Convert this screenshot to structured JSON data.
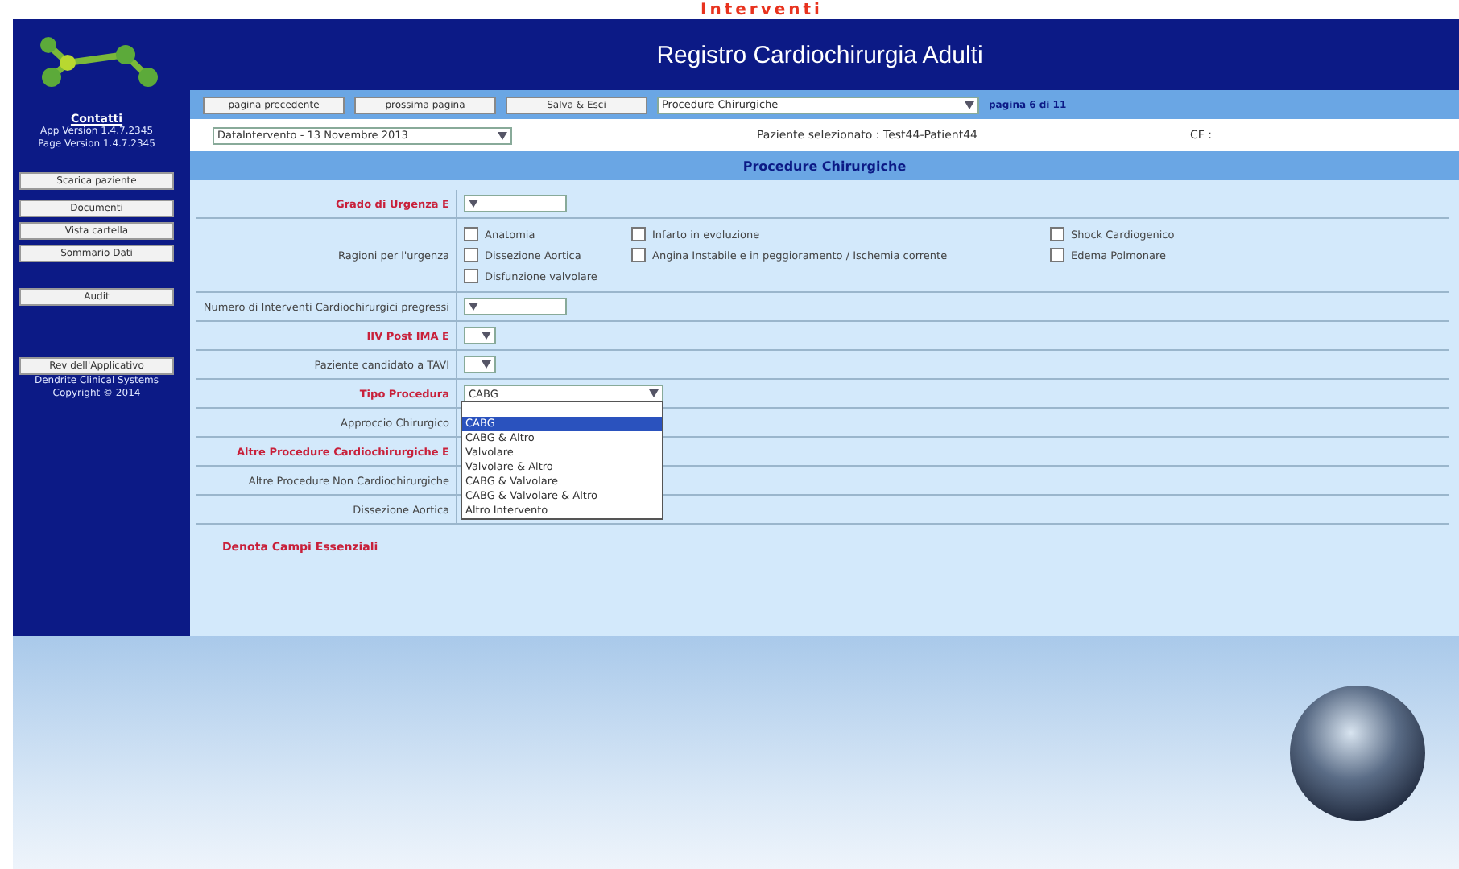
{
  "banner": {
    "title": "Interventi"
  },
  "header": {
    "title": "Registro Cardiochirurgia Adulti"
  },
  "sidebar": {
    "link": "Contatti",
    "versions": [
      "App Version 1.4.7.2345",
      "Page Version 1.4.7.2345"
    ],
    "buttons": [
      "Scarica paziente",
      "Documenti",
      "Vista cartella",
      "Sommario Dati"
    ],
    "audit": "Audit",
    "about": "Rev dell'Applicativo",
    "footer": [
      "Dendrite Clinical Systems",
      "Copyright © 2014"
    ]
  },
  "nav": {
    "buttons": [
      "pagina precedente",
      "prossima pagina",
      "Salva & Esci"
    ],
    "page_select": "Procedure Chirurgiche",
    "page_info": "pagina 6 di 11"
  },
  "patient": {
    "intervention": "DataIntervento - 13 Novembre 2013",
    "selected": "Paziente selezionato : Test44-Patient44",
    "cf": "CF :"
  },
  "section": {
    "title": "Procedure Chirurgiche"
  },
  "rows": [
    {
      "label": "Grado di Urgenza Ε",
      "required": true,
      "kind": "select"
    },
    {
      "label": "Ragioni per l'urgenza",
      "required": false,
      "kind": "checks",
      "options": [
        {
          "label": "Anatomia",
          "checked": false
        },
        {
          "label": "Infarto in evoluzione",
          "checked": false
        },
        {
          "label": "Shock Cardiogenico",
          "checked": false
        },
        {
          "label": "Dissezione Aortica",
          "checked": false
        },
        {
          "label": "Angina Instabile e in peggioramento / Ischemia corrente",
          "checked": false
        },
        {
          "label": "Edema Polmonare",
          "checked": false
        },
        {
          "label": "Disfunzione valvolare",
          "checked": false
        }
      ]
    },
    {
      "label": "Numero di Interventi Cardiochirurgici pregressi",
      "required": false,
      "kind": "select"
    },
    {
      "label": "IIV Post IMA Ε",
      "required": true,
      "kind": "small-select"
    },
    {
      "label": "Paziente candidato a TAVI",
      "required": false,
      "kind": "small-select"
    },
    {
      "label": "Tipo Procedura",
      "required": true,
      "kind": "wide-select",
      "value": "CABG",
      "options": [
        {
          "label": "CABG",
          "selected": true
        },
        {
          "label": "CABG & Altro",
          "selected": false
        },
        {
          "label": "Valvolare",
          "selected": false
        },
        {
          "label": "Valvolare & Altro",
          "selected": false
        },
        {
          "label": "CABG & Valvolare",
          "selected": false
        },
        {
          "label": "CABG & Valvolare & Altro",
          "selected": false
        },
        {
          "label": "Altro Intervento",
          "selected": false
        }
      ]
    },
    {
      "label": "Approccio Chirurgico",
      "required": false,
      "kind": "empty"
    },
    {
      "label": "Altre Procedure Cardiochirurgiche Ε",
      "required": true,
      "kind": "empty"
    },
    {
      "label": "Altre Procedure Non Cardiochirurgiche",
      "required": false,
      "kind": "empty"
    },
    {
      "label": "Dissezione Aortica",
      "required": false,
      "kind": "empty"
    }
  ],
  "legend": "Denota Campi Essenziali"
}
